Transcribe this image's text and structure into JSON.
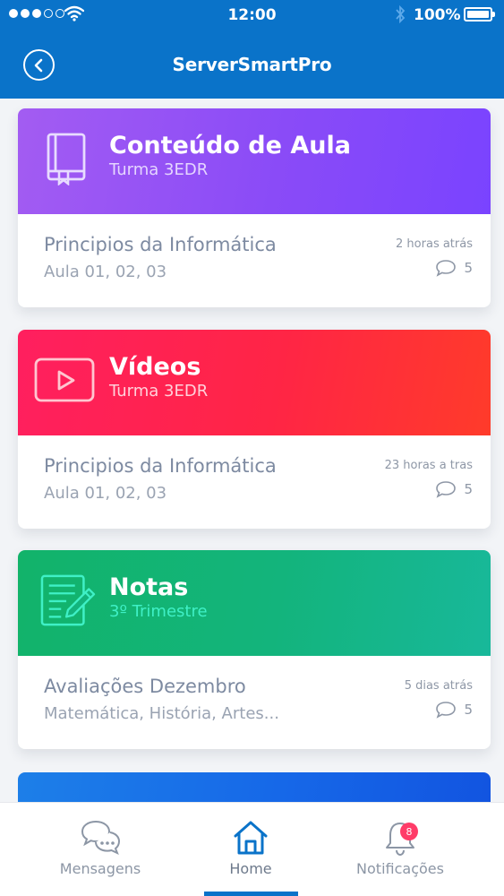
{
  "status_bar": {
    "time": "12:00",
    "battery": "100%",
    "signal_icon": "signal-dots-icon",
    "wifi_icon": "wifi-icon",
    "bluetooth_icon": "bluetooth-icon",
    "battery_icon": "battery-icon"
  },
  "header": {
    "title": "ServerSmartPro",
    "back_icon": "back-arrow-icon",
    "color": "#0a73c9"
  },
  "cards": [
    {
      "title": "Conteúdo de Aula",
      "subtitle": "Turma 3EDR",
      "icon": "book-icon",
      "item_title": "Principios da Informática",
      "item_sub": "Aula 01, 02, 03",
      "time": "2 horas atrás",
      "comments": "5",
      "color": "#8a4bf7"
    },
    {
      "title": "Vídeos",
      "subtitle": "Turma 3EDR",
      "icon": "video-play-icon",
      "item_title": "Principios da Informática",
      "item_sub": "Aula 01, 02, 03",
      "time": "23 horas a tras",
      "comments": "5",
      "color": "#ff2545"
    },
    {
      "title": "Notas",
      "subtitle": "3º Trimestre",
      "icon": "notes-edit-icon",
      "item_title": "Avaliações Dezembro",
      "item_sub": "Matemática, História, Artes...",
      "time": "5 dias atrás",
      "comments": "5",
      "color": "#13b47c"
    }
  ],
  "bottom_nav": {
    "items": [
      {
        "label": "Mensagens",
        "icon": "chat-bubbles-icon"
      },
      {
        "label": "Home",
        "icon": "home-icon",
        "active": true
      },
      {
        "label": "Notificações",
        "icon": "bell-icon",
        "badge": "8"
      }
    ]
  }
}
